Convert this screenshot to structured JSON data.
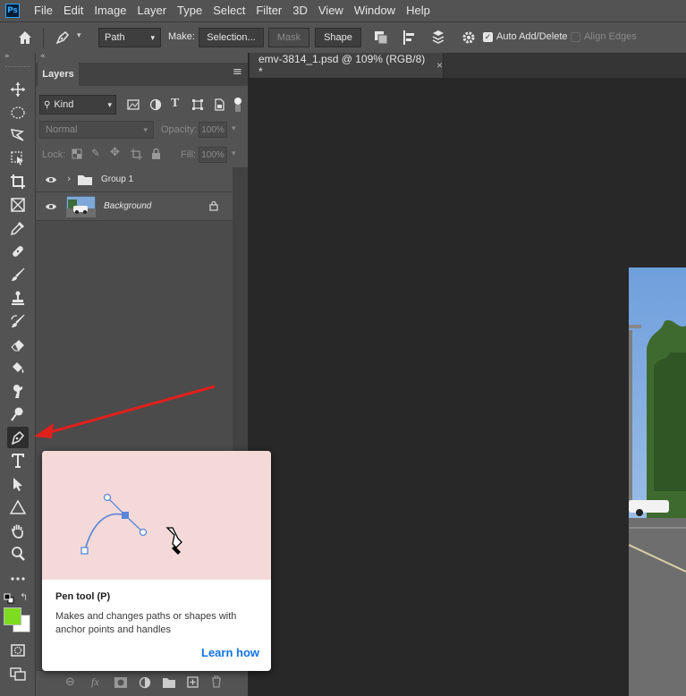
{
  "app": {
    "logo": "Ps"
  },
  "menu": [
    "File",
    "Edit",
    "Image",
    "Layer",
    "Type",
    "Select",
    "Filter",
    "3D",
    "View",
    "Window",
    "Help"
  ],
  "options": {
    "mode_value": "Path",
    "make_label": "Make:",
    "selection_label": "Selection...",
    "mask_label": "Mask",
    "shape_label": "Shape",
    "auto_add_delete_label": "Auto Add/Delete",
    "auto_add_delete_checked": true,
    "align_edges_label": "Align Edges",
    "align_edges_checked": false
  },
  "document": {
    "tab_title": "emv-3814_1.psd @ 109% (RGB/8) *",
    "close_glyph": "×"
  },
  "layers_panel": {
    "tab_label": "Layers",
    "filter_value": "Kind",
    "blend_mode": "Normal",
    "opacity_label": "Opacity:",
    "opacity_value": "100%",
    "lock_label": "Lock:",
    "fill_label": "Fill:",
    "fill_value": "100%",
    "layers": [
      {
        "name": "Group 1",
        "type": "group",
        "visible": true
      },
      {
        "name": "Background",
        "type": "image",
        "visible": true,
        "locked": true
      }
    ]
  },
  "tooltip": {
    "title": "Pen tool (P)",
    "description": "Makes and changes paths or shapes with anchor points and handles",
    "link": "Learn how"
  },
  "colors": {
    "foreground": "#7ddc1f",
    "background": "#ffffff",
    "accent_arrow": "#e0201c",
    "link": "#1473e6"
  },
  "icons": [
    "home-icon",
    "pen-icon",
    "move-icon",
    "marquee-icon",
    "lasso-icon",
    "object-select-icon",
    "crop-icon",
    "frame-icon",
    "eyedropper-icon",
    "healing-icon",
    "brush-icon",
    "stamp-icon",
    "history-brush-icon",
    "eraser-icon",
    "paint-bucket-icon",
    "smudge-icon",
    "dodge-icon",
    "type-icon",
    "path-select-icon",
    "triangle-icon",
    "hand-icon",
    "zoom-icon",
    "more-icon"
  ]
}
